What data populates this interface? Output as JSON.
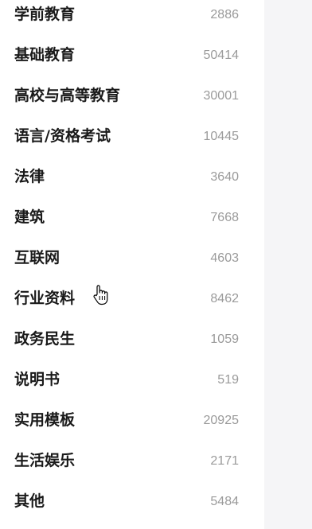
{
  "categories": [
    {
      "name": "学前教育",
      "count": "2886"
    },
    {
      "name": "基础教育",
      "count": "50414"
    },
    {
      "name": "高校与高等教育",
      "count": "30001"
    },
    {
      "name": "语言/资格考试",
      "count": "10445"
    },
    {
      "name": "法律",
      "count": "3640"
    },
    {
      "name": "建筑",
      "count": "7668"
    },
    {
      "name": "互联网",
      "count": "4603"
    },
    {
      "name": "行业资料",
      "count": "8462"
    },
    {
      "name": "政务民生",
      "count": "1059"
    },
    {
      "name": "说明书",
      "count": "519"
    },
    {
      "name": "实用模板",
      "count": "20925"
    },
    {
      "name": "生活娱乐",
      "count": "2171"
    },
    {
      "name": "其他",
      "count": "5484"
    }
  ],
  "cursor": {
    "icon": "hand-pointer-icon"
  },
  "colors": {
    "name_text": "#1a1a1a",
    "count_text": "#9a9a9a",
    "panel_background": "#f5f5f7"
  }
}
